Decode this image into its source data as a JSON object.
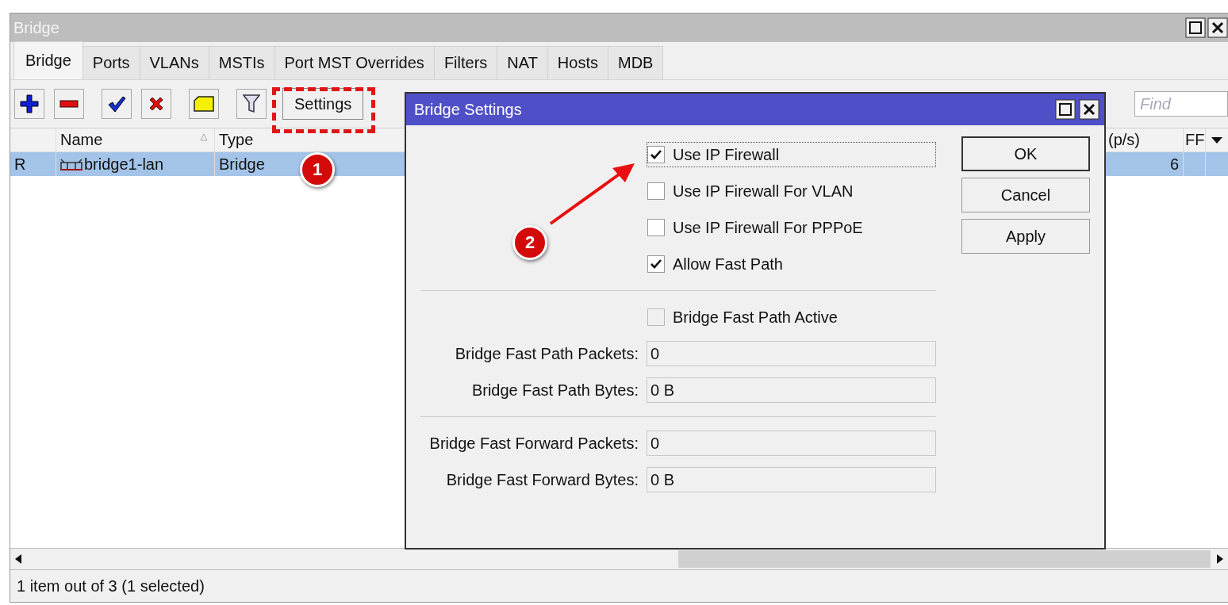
{
  "window": {
    "title": "Bridge"
  },
  "tabs": [
    {
      "label": "Bridge",
      "selected": true
    },
    {
      "label": "Ports",
      "selected": false
    },
    {
      "label": "VLANs",
      "selected": false
    },
    {
      "label": "MSTIs",
      "selected": false
    },
    {
      "label": "Port MST Overrides",
      "selected": false
    },
    {
      "label": "Filters",
      "selected": false
    },
    {
      "label": "NAT",
      "selected": false
    },
    {
      "label": "Hosts",
      "selected": false
    },
    {
      "label": "MDB",
      "selected": false
    }
  ],
  "toolbar": {
    "tools": [
      {
        "kind": "add"
      },
      {
        "kind": "remove"
      },
      {
        "kind": "enable"
      },
      {
        "kind": "disable"
      },
      {
        "kind": "comment"
      },
      {
        "kind": "filter"
      }
    ],
    "settings_button": "Settings"
  },
  "search": {
    "placeholder": "Find"
  },
  "table": {
    "columns": [
      "Name",
      "Type",
      "(p/s)",
      "FF"
    ],
    "rows": [
      {
        "flag": "R",
        "name": "bridge1-lan",
        "type": "Bridge",
        "column_pps": "6",
        "selected": true
      }
    ]
  },
  "status_bar": "1 item out of 3 (1 selected)",
  "dialog": {
    "title": "Bridge Settings",
    "options": [
      {
        "label": "Use IP Firewall",
        "checked": true,
        "focused": true
      },
      {
        "label": "Use IP Firewall For VLAN",
        "checked": false,
        "focused": false
      },
      {
        "label": "Use IP Firewall For PPPoE",
        "checked": false,
        "focused": false
      },
      {
        "label": "Allow Fast Path",
        "checked": true,
        "focused": false
      }
    ],
    "fast_path_active": {
      "label": "Bridge Fast Path Active",
      "checked": false
    },
    "field_groups": [
      [
        {
          "label": "Bridge Fast Path Packets:",
          "value": "0"
        },
        {
          "label": "Bridge Fast Path Bytes:",
          "value": "0 B"
        }
      ],
      [
        {
          "label": "Bridge Fast Forward Packets:",
          "value": "0"
        },
        {
          "label": "Bridge Fast Forward Bytes:",
          "value": "0 B"
        }
      ]
    ],
    "buttons": [
      "OK",
      "Cancel",
      "Apply"
    ]
  },
  "annotations": [
    {
      "label": "1"
    },
    {
      "label": "2"
    }
  ]
}
